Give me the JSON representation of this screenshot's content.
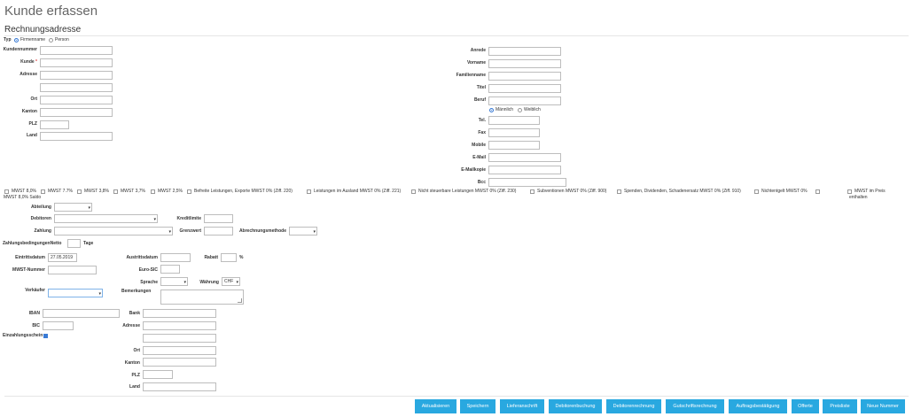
{
  "page": {
    "title": "Kunde erfassen",
    "section": "Rechnungsadresse"
  },
  "typ": {
    "label": "Typ",
    "opt1": "Firmenname",
    "opt2": "Person"
  },
  "left": {
    "kundennummer": "Kundennummer",
    "kunde": "Kunde",
    "required_mark": "*",
    "adresse": "Adresse",
    "ort": "Ort",
    "kanton": "Kanton",
    "plz": "PLZ",
    "land": "Land"
  },
  "right": {
    "anrede": "Anrede",
    "vorname": "Vorname",
    "familienname": "Familienname",
    "titel": "Titel",
    "beruf": "Beruf",
    "gender1": "Männlich",
    "gender2": "Weiblich",
    "tel": "Tel.",
    "fax": "Fax",
    "mobile": "Mobile",
    "email": "E-Mail",
    "emailkopie": "E-Mailkopie",
    "bcc": "Bcc"
  },
  "vat": {
    "items": [
      "MWST 8,0%",
      "MWST 7.7%",
      "MWST 3,8%",
      "MWST 3,7%",
      "MWST 2,5%",
      "Befreite Leistungen, Exporte MWST 0% (Ziff. 220)",
      "Leistungen im Ausland MWST 0% (Ziff. 221)",
      "Nicht steuerbare Leistungen MWST 0% (Ziff. 230)",
      "Subventionen MWST 0% (Ziff. 900)",
      "Spenden, Dividenden, Schadenersatz MWST 0% (Ziff. 910)",
      "Nichtentgelt MWST 0%"
    ],
    "saldo": "MWST 8,0% Saldo",
    "preis_line1": "MWST im Preis",
    "preis_line2": "enthalten"
  },
  "billing": {
    "abteilung": "Abteilung",
    "debitoren": "Debitoren",
    "zahlung": "Zahlung",
    "kreditlimite": "Kreditlimite",
    "grenzwert": "Grenzwert",
    "abrechnungsmethode": "Abrechnungsmethode",
    "zahlungsbedingungen": "ZahlungsbedingungenNetto",
    "tage": "Tage",
    "eintrittsdatum": "Eintrittsdatum",
    "eintrittsdatum_value": "27.05.2019",
    "austrittsdatum": "Austrittsdatum",
    "rabatt": "Rabatt",
    "percent": "%",
    "mwst_nummer": "MWST-Nummer",
    "euro_sic": "Euro-SIC",
    "sprache": "Sprache",
    "waehrung": "Währung",
    "waehrung_value": "CHF",
    "verkaeufer": "Verkäufer",
    "bemerkungen": "Bemerkungen"
  },
  "bank": {
    "iban": "IBAN",
    "bic": "BIC",
    "einzahlungsschein": "Einzahlungsschein",
    "bank": "Bank",
    "adresse": "Adresse",
    "ort": "Ort",
    "kanton": "Kanton",
    "plz": "PLZ",
    "land": "Land"
  },
  "buttons": [
    "Aktualisieren",
    "Speichern",
    "Lieferanschrift",
    "Debitorenbuchung",
    "Debitorenrechnung",
    "Gutschriftsrechnung",
    "Auftragsbestätigung",
    "Offerte",
    "Preisliste",
    "Neue Nummer"
  ],
  "colors": {
    "button": "#29a8e0",
    "accent": "#3a7bd5"
  }
}
